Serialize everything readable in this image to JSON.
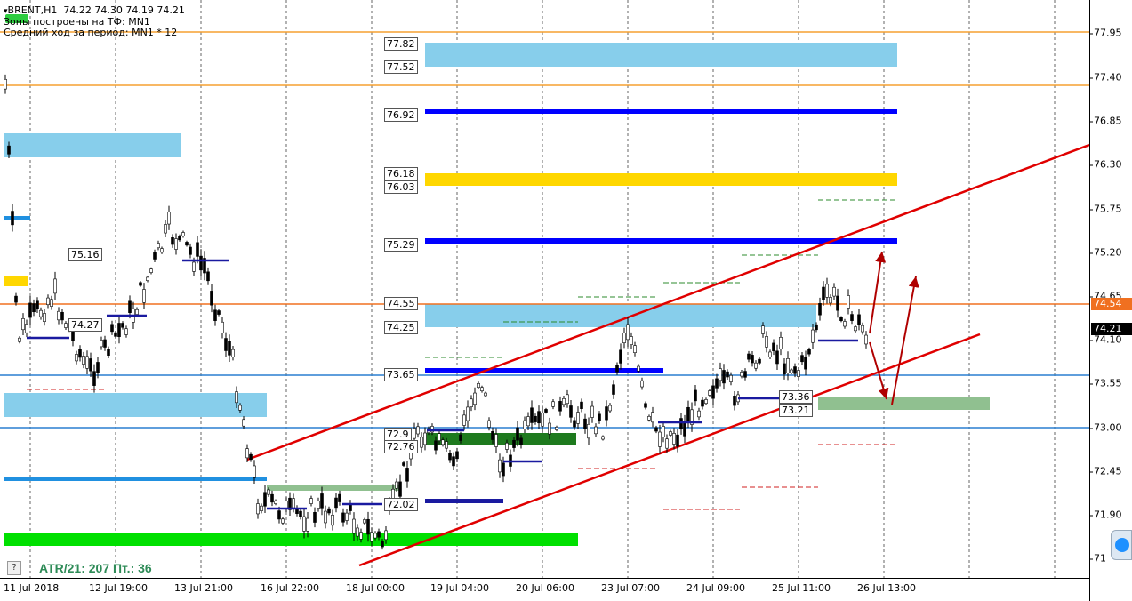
{
  "header": {
    "symbol": "BRENT,H1",
    "ohlc": "74.22 74.30 74.19 74.21",
    "zones_line": "Зоны построены на ТФ: MN1",
    "avg_range_line": "Средний ход за период: MN1 * 12"
  },
  "atr_text": "ATR/21: 207  Пт.: 36",
  "help_label": "?",
  "price_axis": [
    "77.95",
    "77.40",
    "76.85",
    "76.30",
    "75.75",
    "75.20",
    "74.65",
    "74.10",
    "73.55",
    "73.00",
    "72.45",
    "71.90",
    "71"
  ],
  "price_markers": {
    "orange_level": "74.54",
    "current_price": "74.21"
  },
  "time_axis": [
    "11 Jul 2018",
    "12 Jul 19:00",
    "13 Jul 21:00",
    "16 Jul 22:00",
    "18 Jul 00:00",
    "19 Jul 04:00",
    "20 Jul 06:00",
    "23 Jul 07:00",
    "24 Jul 09:00",
    "25 Jul 11:00",
    "26 Jul 13:00"
  ],
  "zone_labels": [
    {
      "text": "77.82"
    },
    {
      "text": "77.52"
    },
    {
      "text": "76.92"
    },
    {
      "text": "76.18"
    },
    {
      "text": "76.03"
    },
    {
      "text": "75.29"
    },
    {
      "text": "74.55"
    },
    {
      "text": "74.25"
    },
    {
      "text": "73.65"
    },
    {
      "text": "72.9"
    },
    {
      "text": "72.76"
    },
    {
      "text": "72.02"
    },
    {
      "text": "75.16"
    },
    {
      "text": "74.27"
    },
    {
      "text": "73.36"
    },
    {
      "text": "73.21"
    }
  ],
  "colors": {
    "light_blue_zone": "#87ceeb",
    "dark_blue_level": "#0000ff",
    "yellow_zone": "#ffd700",
    "green_zone": "#00e000",
    "dark_green_zone": "#1e7a1e",
    "pale_green_zone": "#90c090",
    "orange_line": "#f5a030",
    "channel_red": "#e00000",
    "arrow_red": "#b00000",
    "candles": "#000000"
  }
}
